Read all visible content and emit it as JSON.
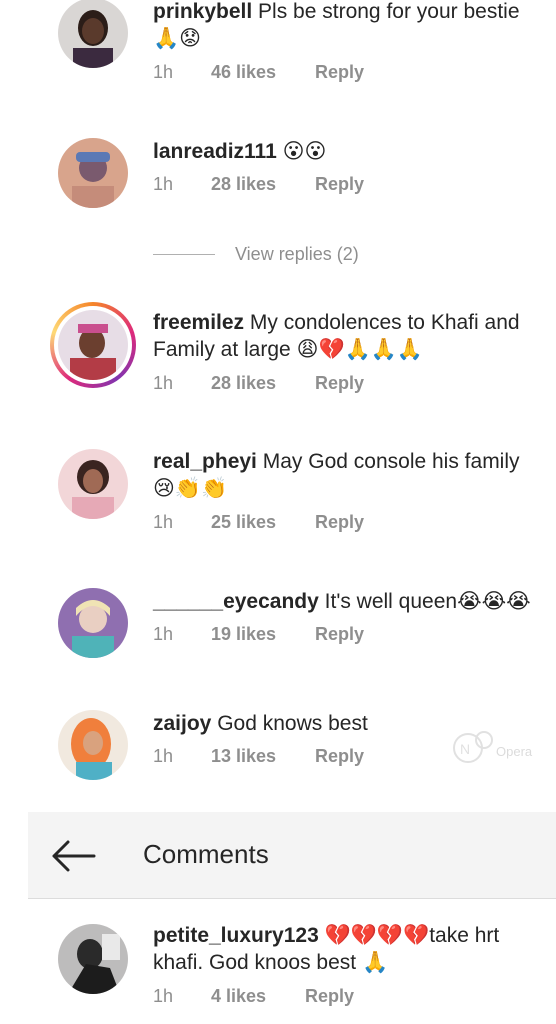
{
  "header": {
    "title": "Comments",
    "back_icon": "arrow-left-icon"
  },
  "view_replies": "View replies (2)",
  "watermark": "Opera",
  "comments": [
    {
      "username": "prinkybell",
      "text": "Pls be strong for your bestie",
      "emoji": "🙏😟",
      "time": "1h",
      "likes": "46 likes",
      "reply": "Reply"
    },
    {
      "username": "lanreadiz111",
      "text": "",
      "emoji": "😮😮",
      "time": "1h",
      "likes": "28 likes",
      "reply": "Reply"
    },
    {
      "username": "freemilez",
      "text": "My condolences to Khafi and Family at large",
      "emoji": "😩💔🙏🙏🙏",
      "time": "1h",
      "likes": "28 likes",
      "reply": "Reply"
    },
    {
      "username": "real_pheyi",
      "text": "May God console his family",
      "emoji": "😢👏👏",
      "time": "1h",
      "likes": "25 likes",
      "reply": "Reply"
    },
    {
      "username": "______eyecandy",
      "text": "It's well queen",
      "emoji": "😭😭😭",
      "time": "1h",
      "likes": "19 likes",
      "reply": "Reply"
    },
    {
      "username": "zaijoy",
      "text": "God knows best",
      "emoji": "",
      "time": "1h",
      "likes": "13 likes",
      "reply": "Reply"
    },
    {
      "username": "petite_luxury123",
      "text": "take hrt khafi. God knoos best",
      "emoji_before": "💔💔💔💔",
      "emoji": "🙏",
      "time": "1h",
      "likes": "4 likes",
      "reply": "Reply"
    }
  ]
}
